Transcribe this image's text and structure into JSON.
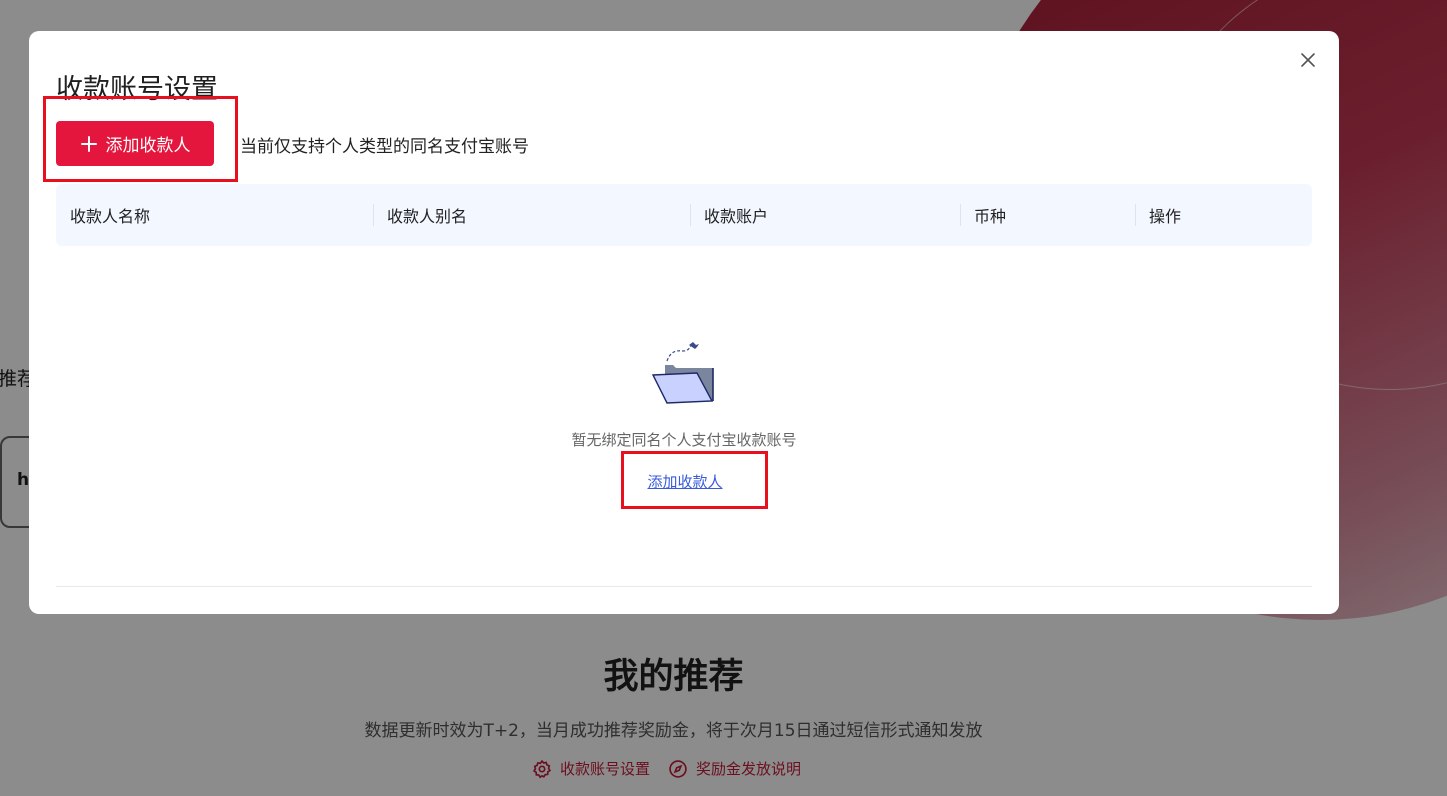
{
  "background": {
    "left_text": "推荐",
    "left_card_text": "h",
    "heading": "我的推荐",
    "subtitle": "数据更新时效为T+2，当月成功推荐奖励金，将于次月15日通过短信形式通知发放",
    "links": [
      {
        "label": "收款账号设置",
        "icon": "gear-icon"
      },
      {
        "label": "奖励金发放说明",
        "icon": "compass-icon"
      }
    ]
  },
  "modal": {
    "title": "收款账号设置",
    "add_button_label": "添加收款人",
    "hint": "当前仅支持个人类型的同名支付宝账号",
    "table": {
      "columns": [
        "收款人名称",
        "收款人别名",
        "收款账户",
        "币种",
        "操作"
      ]
    },
    "empty": {
      "message": "暂无绑定同名个人支付宝收款账号",
      "link_label": "添加收款人"
    }
  },
  "colors": {
    "brand_red": "#e4163d",
    "link_blue": "#3a5bdc",
    "annotation_red": "#e8101e",
    "table_header_bg": "#f3f7ff"
  }
}
